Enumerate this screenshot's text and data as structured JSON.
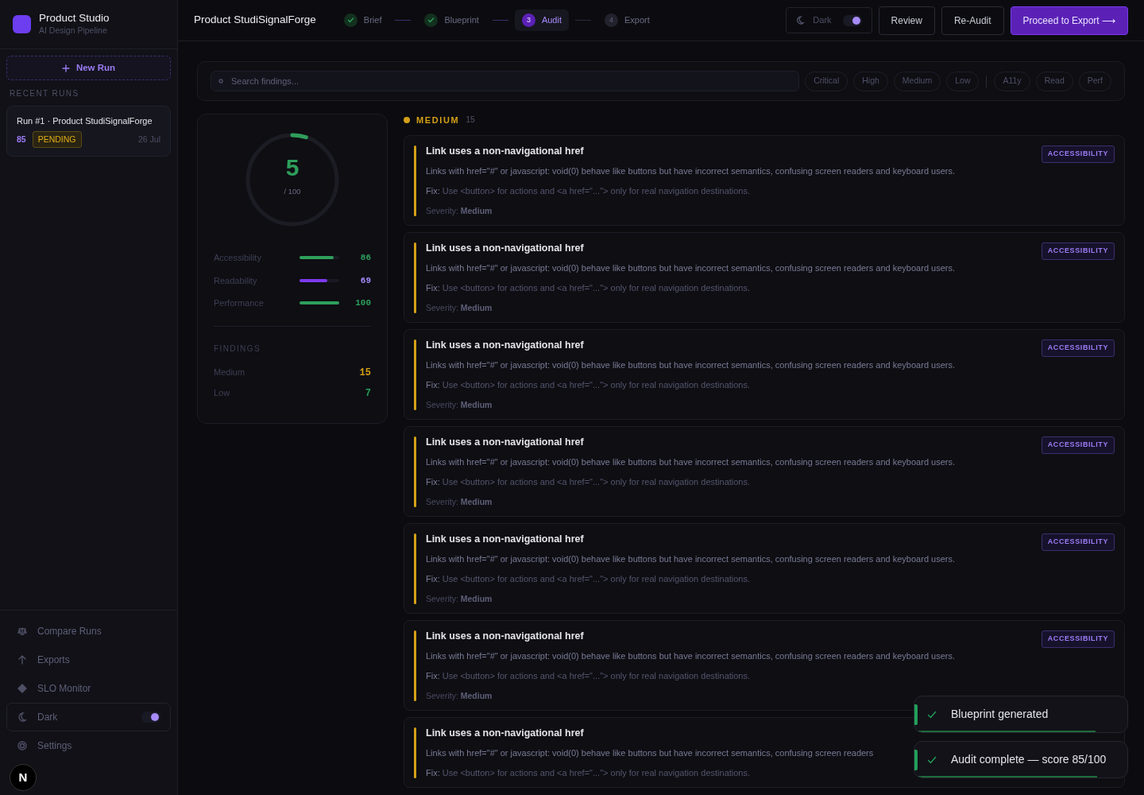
{
  "brand": {
    "title": "Product Studio",
    "subtitle": "AI Design Pipeline"
  },
  "sidebar": {
    "new_run": "New Run",
    "recent_label": "RECENT RUNS",
    "runs": [
      {
        "title": "Run #1 · Product StudiSignalForge",
        "score": "85",
        "status": "PENDING",
        "date": "26 Jul",
        "selected": false
      }
    ],
    "nav": [
      {
        "kind": "link",
        "label": "Compare Runs"
      },
      {
        "kind": "link",
        "label": "Exports"
      },
      {
        "kind": "link",
        "label": "SLO Monitor"
      },
      {
        "kind": "toggle",
        "label": "Dark",
        "on": true
      },
      {
        "kind": "link",
        "label": "Settings"
      }
    ]
  },
  "header": {
    "title": "Product StudiSignalForge",
    "steps": [
      {
        "label": "Brief",
        "done": true,
        "selected": false
      },
      {
        "label": "Blueprint",
        "done": true,
        "selected": false
      },
      {
        "label": "Audit",
        "number": "3",
        "done": false,
        "selected": true
      },
      {
        "label": "Export",
        "number": "4",
        "done": false,
        "selected": false
      }
    ],
    "theme_toggle": {
      "label": "Dark",
      "on": true
    },
    "buttons": [
      {
        "label": "Review",
        "kind": "outline"
      },
      {
        "label": "Re-Audit",
        "kind": "outline"
      },
      {
        "label": "Proceed to Export ⟶",
        "kind": "primary"
      }
    ]
  },
  "filters": {
    "placeholder": "Search findings...",
    "severity_chips": [
      {
        "label": "Critical",
        "selected": false
      },
      {
        "label": "High",
        "selected": false
      },
      {
        "label": "Medium",
        "selected": false
      },
      {
        "label": "Low",
        "selected": false
      }
    ],
    "category_chips": [
      {
        "label": "A11y",
        "selected": false
      },
      {
        "label": "Read",
        "selected": false
      },
      {
        "label": "Perf",
        "selected": false
      }
    ]
  },
  "score": {
    "value": "5",
    "out_of": "/ 100",
    "level": 0.05,
    "metrics": [
      {
        "label": "Accessibility",
        "level": 0.86,
        "reading": "86",
        "color": "#2e9e5b"
      },
      {
        "label": "Readability",
        "level": 0.69,
        "reading": "69",
        "color": "#7c3aed"
      },
      {
        "label": "Performance",
        "level": 1.0,
        "reading": "100",
        "color": "#2e9e5b"
      }
    ],
    "findings_label": "FINDINGS",
    "counts": [
      {
        "label": "Medium",
        "count": "15",
        "color": "#d4a017"
      },
      {
        "label": "Low",
        "count": "7",
        "color": "#22a05a"
      }
    ]
  },
  "group": {
    "label": "MEDIUM",
    "count": "15",
    "color": "#d4a017"
  },
  "findings": [
    {
      "title": "Link uses a non-navigational href",
      "badge": "ACCESSIBILITY",
      "description": "Links with href=\"#\" or javascript: void(0) behave like buttons but have incorrect semantics, confusing screen readers and keyboard users.",
      "fix_label": "Fix:",
      "fix": "Use <button> for actions and <a href=\"...\"> only for real navigation destinations.",
      "severity_label": "Severity:",
      "severity": "Medium"
    },
    {
      "title": "Link uses a non-navigational href",
      "badge": "ACCESSIBILITY",
      "description": "Links with href=\"#\" or javascript: void(0) behave like buttons but have incorrect semantics, confusing screen readers and keyboard users.",
      "fix_label": "Fix:",
      "fix": "Use <button> for actions and <a href=\"...\"> only for real navigation destinations.",
      "severity_label": "Severity:",
      "severity": "Medium"
    },
    {
      "title": "Link uses a non-navigational href",
      "badge": "ACCESSIBILITY",
      "description": "Links with href=\"#\" or javascript: void(0) behave like buttons but have incorrect semantics, confusing screen readers and keyboard users.",
      "fix_label": "Fix:",
      "fix": "Use <button> for actions and <a href=\"...\"> only for real navigation destinations.",
      "severity_label": "Severity:",
      "severity": "Medium"
    },
    {
      "title": "Link uses a non-navigational href",
      "badge": "ACCESSIBILITY",
      "description": "Links with href=\"#\" or javascript: void(0) behave like buttons but have incorrect semantics, confusing screen readers and keyboard users.",
      "fix_label": "Fix:",
      "fix": "Use <button> for actions and <a href=\"...\"> only for real navigation destinations.",
      "severity_label": "Severity:",
      "severity": "Medium"
    },
    {
      "title": "Link uses a non-navigational href",
      "badge": "ACCESSIBILITY",
      "description": "Links with href=\"#\" or javascript: void(0) behave like buttons but have incorrect semantics, confusing screen readers and keyboard users.",
      "fix_label": "Fix:",
      "fix": "Use <button> for actions and <a href=\"...\"> only for real navigation destinations.",
      "severity_label": "Severity:",
      "severity": "Medium"
    },
    {
      "title": "Link uses a non-navigational href",
      "badge": "ACCESSIBILITY",
      "description": "Links with href=\"#\" or javascript: void(0) behave like buttons but have incorrect semantics, confusing screen readers and keyboard users.",
      "fix_label": "Fix:",
      "fix": "Use <button> for actions and <a href=\"...\"> only for real navigation destinations.",
      "severity_label": "Severity:",
      "severity": "Medium"
    },
    {
      "title": "Link uses a non-navigational href",
      "description": "Links with href=\"#\" or javascript: void(0) behave like buttons but have incorrect semantics, confusing screen readers",
      "fix_label": "Fix:",
      "fix": "Use <button> for actions and <a href=\"...\"> only for real navigation destinations."
    }
  ],
  "toasts": [
    {
      "message": "Blueprint generated",
      "level": 0.85
    },
    {
      "message": "Audit complete — score 85/100",
      "level": 0.86
    }
  ],
  "dev_badge": "N"
}
